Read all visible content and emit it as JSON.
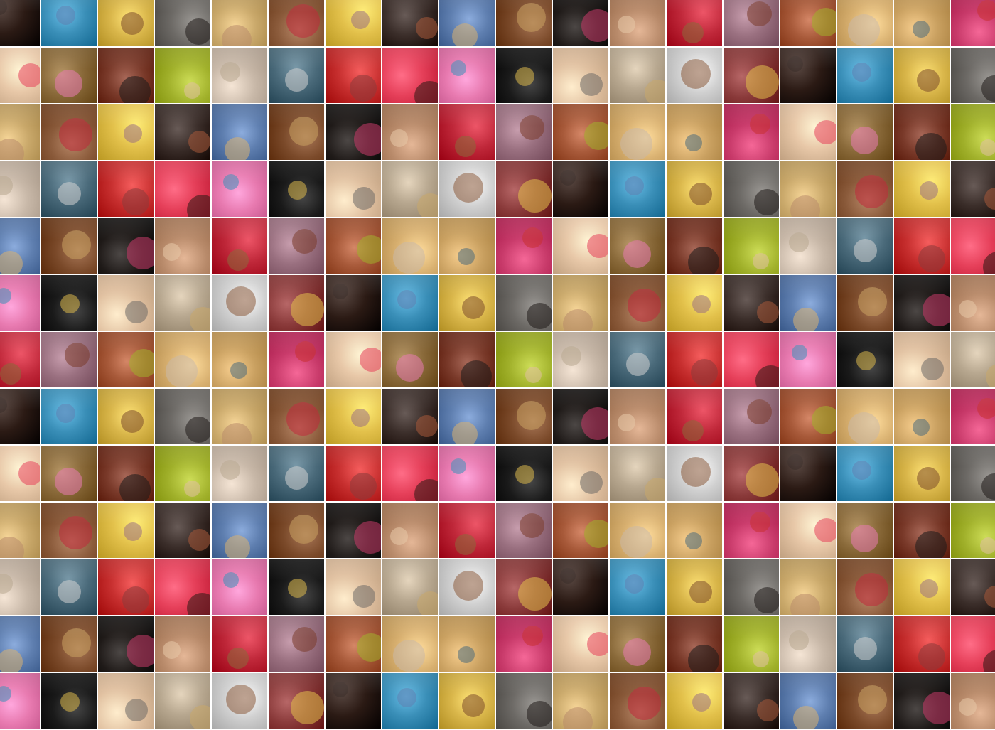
{
  "collage": {
    "palette": [
      "#2b1a14",
      "#3a8fb8",
      "#d9b64a",
      "#6d6a66",
      "#c9a86a",
      "#8a5a3a",
      "#e2c04a",
      "#3b2e2a",
      "#5f7fb0",
      "#7b4a2a",
      "#1f1a18",
      "#b88a6a",
      "#c0283a",
      "#9a7080",
      "#a85a3a",
      "#d8b070",
      "#c9a060",
      "#c83a6a",
      "#e8c8a8",
      "#8a6a3a",
      "#7a3a2a",
      "#a0b02a",
      "#c8b8a8",
      "#4a6a7a",
      "#c83030",
      "#e6405a",
      "#e87ab0",
      "#1a1a1a",
      "#e0c0a0",
      "#b8a890",
      "#d0d0d0",
      "#8a3a3a"
    ],
    "row_pattern": [
      [
        0,
        1,
        2,
        3,
        4,
        5,
        6,
        7,
        8,
        9,
        10,
        11,
        12,
        13,
        14,
        15,
        16,
        17
      ],
      [
        18,
        19,
        20,
        21,
        22,
        23,
        24,
        25,
        26,
        27,
        28,
        29,
        30,
        31,
        0,
        1,
        2,
        3
      ],
      [
        4,
        5,
        6,
        7,
        8,
        9,
        10,
        11,
        12,
        13,
        14,
        15,
        16,
        17,
        18,
        19,
        20,
        21
      ],
      [
        22,
        23,
        24,
        25,
        26,
        27,
        28,
        29,
        30,
        31,
        0,
        1,
        2,
        3,
        4,
        5,
        6,
        7
      ],
      [
        8,
        9,
        10,
        11,
        12,
        13,
        14,
        15,
        16,
        17,
        18,
        19,
        20,
        21,
        22,
        23,
        24,
        25
      ],
      [
        26,
        27,
        28,
        29,
        30,
        31,
        0,
        1,
        2,
        3,
        4,
        5,
        6,
        7,
        8,
        9,
        10,
        11
      ],
      [
        12,
        13,
        14,
        15,
        16,
        17,
        18,
        19,
        20,
        21,
        22,
        23,
        24,
        25,
        26,
        27,
        28,
        29
      ]
    ]
  }
}
